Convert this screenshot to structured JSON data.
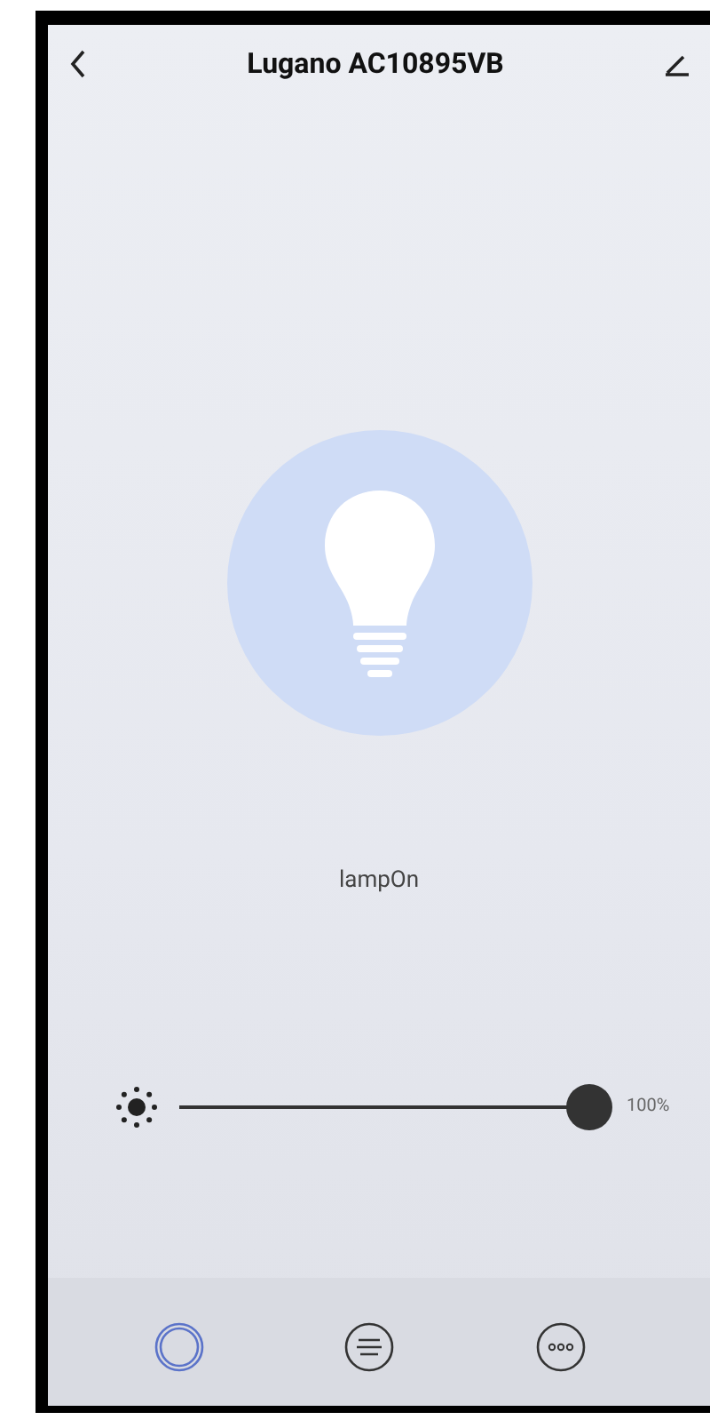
{
  "header": {
    "title": "Lugano AC10895VB"
  },
  "lamp": {
    "on": true,
    "status": "lampOn"
  },
  "brightness": {
    "level": 1,
    "reading": "100%"
  },
  "nav": [
    {
      "kind": "power",
      "selected": true
    },
    {
      "kind": "menu",
      "selected": false
    },
    {
      "kind": "more",
      "selected": false
    }
  ]
}
